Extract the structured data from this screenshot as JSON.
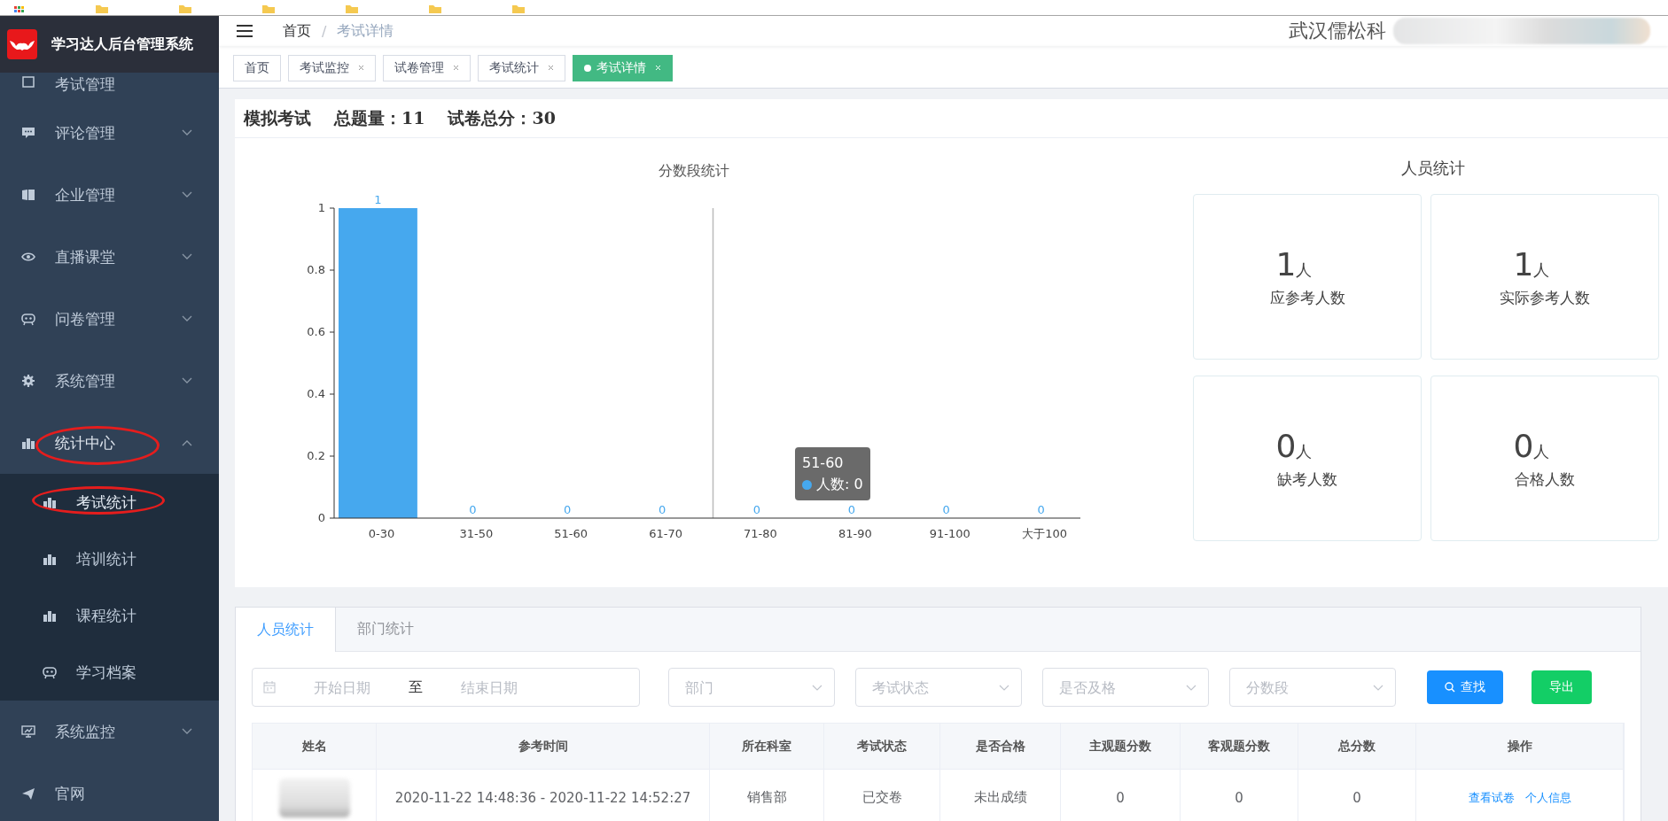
{
  "app": {
    "title": "学习达人后台管理系统"
  },
  "sidebar": {
    "items": [
      {
        "label": "考试管理",
        "kind": "menu"
      },
      {
        "label": "评论管理",
        "kind": "menu",
        "expanded": false
      },
      {
        "label": "企业管理",
        "kind": "menu",
        "expanded": false
      },
      {
        "label": "直播课堂",
        "kind": "menu",
        "expanded": false
      },
      {
        "label": "问卷管理",
        "kind": "menu",
        "expanded": false
      },
      {
        "label": "系统管理",
        "kind": "menu",
        "expanded": false
      },
      {
        "label": "统计中心",
        "kind": "menu",
        "expanded": true,
        "children": [
          {
            "label": "考试统计",
            "selected": true
          },
          {
            "label": "培训统计",
            "selected": false
          },
          {
            "label": "课程统计",
            "selected": false
          },
          {
            "label": "学习档案",
            "selected": false
          }
        ]
      },
      {
        "label": "系统监控",
        "kind": "menu",
        "expanded": false
      },
      {
        "label": "官网",
        "kind": "link"
      }
    ]
  },
  "header": {
    "breadcrumb": [
      "首页",
      "考试详情"
    ],
    "breadcrumb_separator": "/",
    "user": "武汉儒松科"
  },
  "tabs": [
    {
      "label": "首页",
      "selected": false,
      "closable": false
    },
    {
      "label": "考试监控",
      "selected": false,
      "closable": true
    },
    {
      "label": "试卷管理",
      "selected": false,
      "closable": true
    },
    {
      "label": "考试统计",
      "selected": false,
      "closable": true
    },
    {
      "label": "考试详情",
      "selected": true,
      "closable": true
    }
  ],
  "summary": {
    "exam_name": "模拟考试",
    "question_count": "总题量：11",
    "total_score": "试卷总分：30"
  },
  "score_chart": {
    "chart_data": {
      "type": "bar",
      "title": "分数段统计",
      "categories": [
        "0-30",
        "31-50",
        "51-60",
        "61-70",
        "71-80",
        "81-90",
        "91-100",
        "大于100"
      ],
      "series": [
        {
          "name": "人数",
          "color": "#46a8ee",
          "values": [
            1,
            0,
            0,
            0,
            0,
            0,
            0,
            0
          ]
        }
      ],
      "ylim": [
        0,
        1
      ],
      "yticks": [
        0,
        0.2,
        0.4,
        0.6,
        0.8,
        1
      ],
      "data_labels": true
    },
    "tooltip": {
      "title": "51-60",
      "value": ": 0"
    }
  },
  "people_stats": {
    "title": "人员统计",
    "cards": [
      {
        "value": "1",
        "unit": "人",
        "label": "应参考人数"
      },
      {
        "value": "1",
        "unit": "人",
        "label": "实际参考人数"
      },
      {
        "value": "0",
        "unit": "人",
        "label": "缺考人数"
      },
      {
        "value": "0",
        "unit": "人",
        "label": "合格人数"
      }
    ]
  },
  "detail_tabs": [
    {
      "label": "人员统计",
      "selected": true
    },
    {
      "label": "部门统计",
      "selected": false
    }
  ],
  "filters": {
    "start_date": {
      "placeholder": "开始日期"
    },
    "separator": "至",
    "end_date": {
      "placeholder": "结束日期"
    },
    "selects": [
      {
        "placeholder": "部门"
      },
      {
        "placeholder": "考试状态"
      },
      {
        "placeholder": "是否及格"
      },
      {
        "placeholder": "分数段"
      }
    ],
    "search_button": "查找",
    "export_button": "导出"
  },
  "table": {
    "columns": [
      "姓名",
      "参考时间",
      "所在科室",
      "考试状态",
      "是否合格",
      "主观题分数",
      "客观题分数",
      "总分数",
      "操作"
    ],
    "rows": [
      {
        "cells": [
          "",
          "2020-11-22 14:48:36 - 2020-11-22 14:52:27",
          "销售部",
          "已交卷",
          "未出成绩",
          "0",
          "0",
          "0"
        ],
        "actions": [
          "查看试卷",
          "个人信息"
        ]
      }
    ]
  }
}
